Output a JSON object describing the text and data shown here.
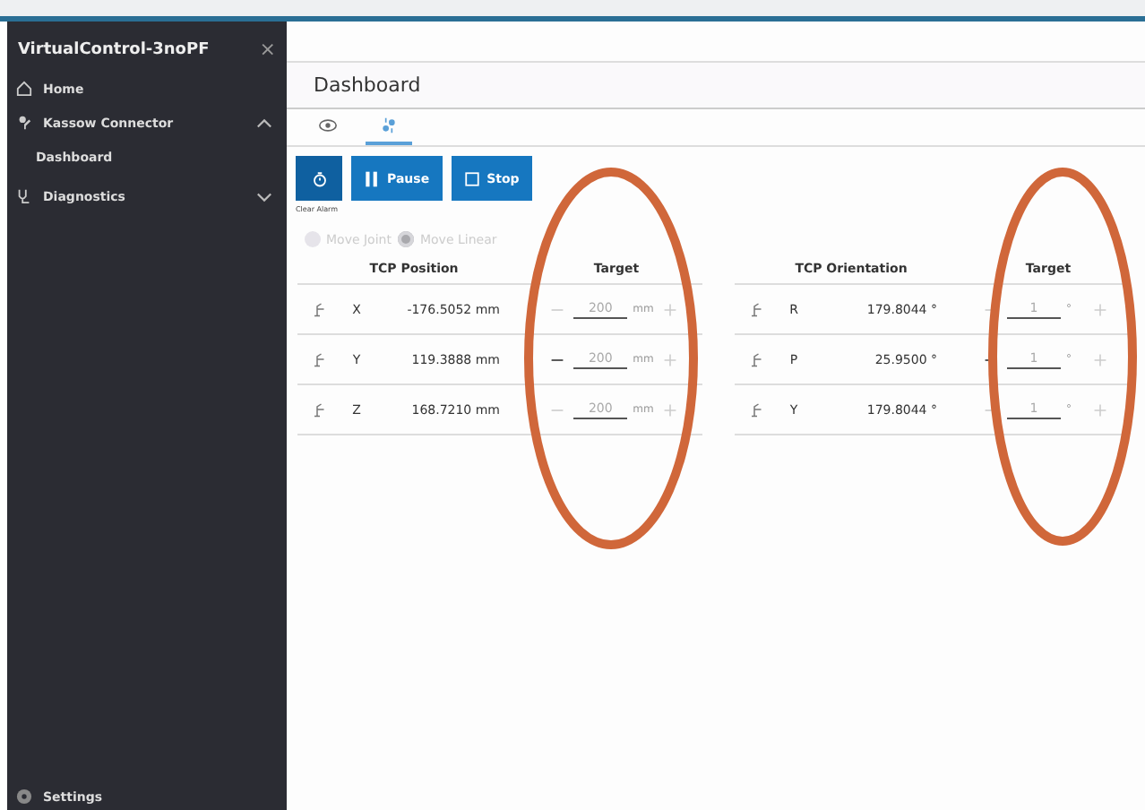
{
  "sidebar": {
    "title": "VirtualControl-3noPF",
    "close": "×",
    "items": [
      {
        "label": "Home"
      },
      {
        "label": "Kassow Connector",
        "expanded": true,
        "children": [
          {
            "label": "Dashboard"
          }
        ]
      },
      {
        "label": "Diagnostics",
        "expanded": false
      }
    ],
    "footer": "Settings"
  },
  "page_title": "Dashboard",
  "tabs": [
    {
      "kind": "view",
      "selected": false
    },
    {
      "kind": "jog",
      "selected": true
    }
  ],
  "actions": [
    {
      "kind": "alarm",
      "caption": "Clear Alarm"
    },
    {
      "kind": "pause",
      "label": "Pause"
    },
    {
      "kind": "stop",
      "label": "Stop"
    }
  ],
  "modes": [
    {
      "label": "Move Joint",
      "selected": false
    },
    {
      "label": "Move Linear",
      "selected": true
    }
  ],
  "tables": [
    {
      "heading": "TCP Position",
      "target_heading": "Target",
      "rows": [
        {
          "axis": "X",
          "value": "-176.5052 mm",
          "target": "200",
          "unit": "mm",
          "minus_disabled": true
        },
        {
          "axis": "Y",
          "value": "119.3888 mm",
          "target": "200",
          "unit": "mm",
          "minus_disabled": false
        },
        {
          "axis": "Z",
          "value": "168.7210 mm",
          "target": "200",
          "unit": "mm",
          "minus_disabled": true
        }
      ]
    },
    {
      "heading": "TCP Orientation",
      "target_heading": "Target",
      "rows": [
        {
          "axis": "R",
          "value": "179.8044 °",
          "target": "1",
          "unit": "°",
          "minus_disabled": true
        },
        {
          "axis": "P",
          "value": "25.9500 °",
          "target": "1",
          "unit": "°",
          "minus_disabled": false
        },
        {
          "axis": "Y",
          "value": "179.8044 °",
          "target": "1",
          "unit": "°",
          "minus_disabled": true
        }
      ]
    }
  ]
}
